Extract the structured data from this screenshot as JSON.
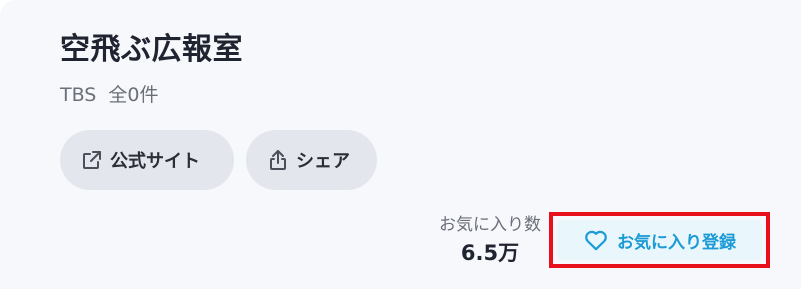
{
  "program": {
    "title": "空飛ぶ広報室",
    "broadcaster": "TBS",
    "episode_count": "全0件"
  },
  "actions": {
    "official_site_label": "公式サイト",
    "share_label": "シェア",
    "official_site_icon": "external-link-icon",
    "share_icon": "share-icon"
  },
  "favorites": {
    "count_label": "お気に入り数",
    "count_value": "6.5万",
    "register_label": "お気に入り登録",
    "register_icon": "heart-icon",
    "accent_color": "#1a9ad6",
    "highlight_color": "#e8101c"
  }
}
